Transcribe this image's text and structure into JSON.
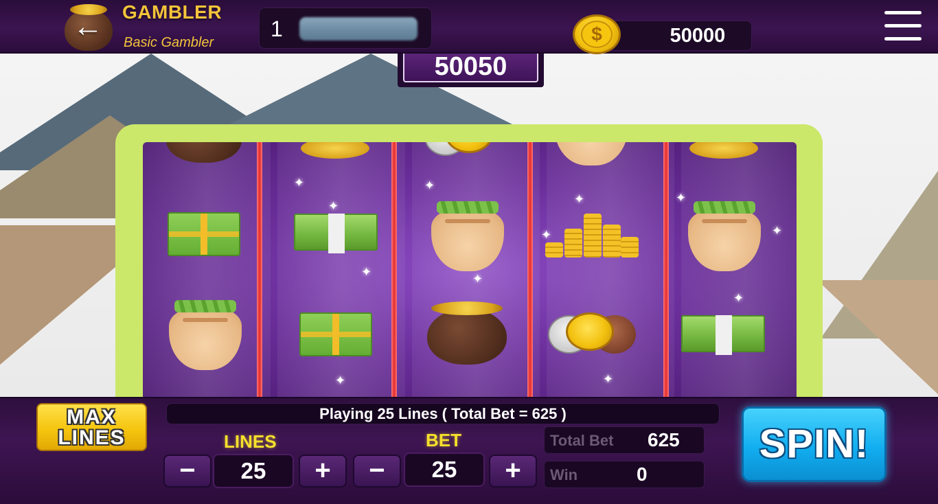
{
  "header": {
    "title": "GAMBLER",
    "subtitle": "Basic Gambler",
    "level": "1",
    "coins": "50000",
    "coin_symbol": "$"
  },
  "jackpot": "50050",
  "reels": [
    [
      "pot-of-gold",
      "cash-bundle",
      "money-bag"
    ],
    [
      "coin-stack",
      "cash-stack",
      "cash-bundle"
    ],
    [
      "coins",
      "money-bag",
      "pot-of-gold"
    ],
    [
      "money-bag",
      "coin-tower",
      "coins"
    ],
    [
      "coin-stack",
      "money-bag",
      "cash-stack"
    ]
  ],
  "controls": {
    "max_lines": [
      "MAX",
      "LINES"
    ],
    "status": "Playing 25 Lines ( Total Bet = 625 )",
    "lines_label": "LINES",
    "lines_value": "25",
    "bet_label": "BET",
    "bet_value": "25",
    "minus": "−",
    "plus": "+",
    "total_bet_label": "Total Bet",
    "total_bet_value": "625",
    "win_label": "Win",
    "win_value": "0",
    "spin": "SPIN!"
  },
  "colors": {
    "frame": "#cbe86a",
    "gold": "#f3c43a",
    "spin": "#12aef0",
    "divider": "#e22b2b"
  }
}
